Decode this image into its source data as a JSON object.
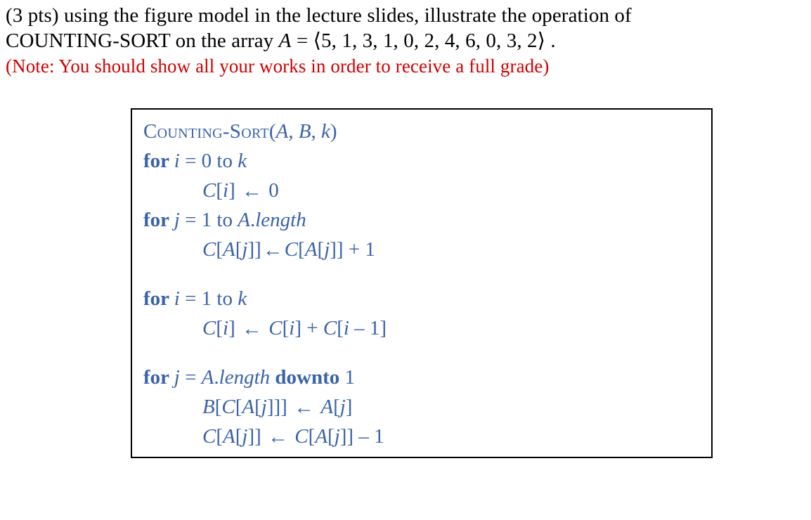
{
  "question": {
    "part1": "(3 pts) using the figure model in the lecture slides, illustrate the operation of",
    "part2_prefix": "COUNTING-SORT on the array ",
    "part2_var": "A",
    "part2_eq": " =   ⟨5, 1, 3, 1, 0, 2, 4, 6, 0, 3, 2⟩  ."
  },
  "note": {
    "open": "(",
    "text": "Note: You should show all your works in order to receive a full grade",
    "close": ")"
  },
  "algo": {
    "title_sc": "Counting-Sort",
    "title_args_open": "(",
    "title_arg1": "A",
    "title_sep1": ", ",
    "title_arg2": "B",
    "title_sep2": ", ",
    "title_arg3": "k",
    "title_args_close": ")",
    "l1_for": "for ",
    "l1_var": "i",
    "l1_rest": " = 0 to ",
    "l1_k": "k",
    "l2_C": "C",
    "l2_open": "[",
    "l2_i": "i",
    "l2_close": "]  ",
    "l2_arrow": "←",
    "l2_zero": "  0",
    "l3_for": "for ",
    "l3_var": "j",
    "l3_eq": " = 1 to ",
    "l3_Alen1": "A",
    "l3_dot": ".",
    "l3_len": "length",
    "l4_left_C": "C",
    "l4_left_open": "[",
    "l4_left_A": "A",
    "l4_left_openb": "[",
    "l4_left_j": "j",
    "l4_left_closeb": "]]",
    "l4_arrow": "  ←  ",
    "l4_right_C": "C",
    "l4_right_open": "[",
    "l4_right_A": "A",
    "l4_right_openb": "[",
    "l4_right_j": "j",
    "l4_right_closeb": "]] + 1",
    "l5_for": "for ",
    "l5_var": "i",
    "l5_eq": " = 1 to ",
    "l5_k": "k",
    "l6_C": "C",
    "l6_open": "[",
    "l6_i": "i",
    "l6_close": "] ",
    "l6_arrow": "←",
    "l6_rhs_sp": "  ",
    "l6_C2": "C",
    "l6_open2": "[",
    "l6_i2": "i",
    "l6_close2": "] + ",
    "l6_C3": "C",
    "l6_open3": "[",
    "l6_i3": "i",
    "l6_minus": " – 1]",
    "l7_for": "for ",
    "l7_var": "j",
    "l7_eq": " = ",
    "l7_A": "A",
    "l7_dot": ".",
    "l7_len": "length",
    "l7_sp": " ",
    "l7_downto": "downto",
    "l7_one": " 1",
    "l8_B": "B",
    "l8_open": "[",
    "l8_C": "C",
    "l8_open2": "[",
    "l8_A": "A",
    "l8_open3": "[",
    "l8_j": "j",
    "l8_close": "]]] ",
    "l8_arrow": "←",
    "l8_sp": "  ",
    "l8_A2": "A",
    "l8_open4": "[",
    "l8_j2": "j",
    "l8_close2": "]",
    "l9_C": "C",
    "l9_open": "[",
    "l9_A": "A",
    "l9_open2": "[",
    "l9_j": "j",
    "l9_close": "]] ",
    "l9_arrow": "←",
    "l9_sp": "  ",
    "l9_C2": "C",
    "l9_open3": "[",
    "l9_A2": "A",
    "l9_open4": "[",
    "l9_j2": "j",
    "l9_close2": "]] – 1"
  }
}
